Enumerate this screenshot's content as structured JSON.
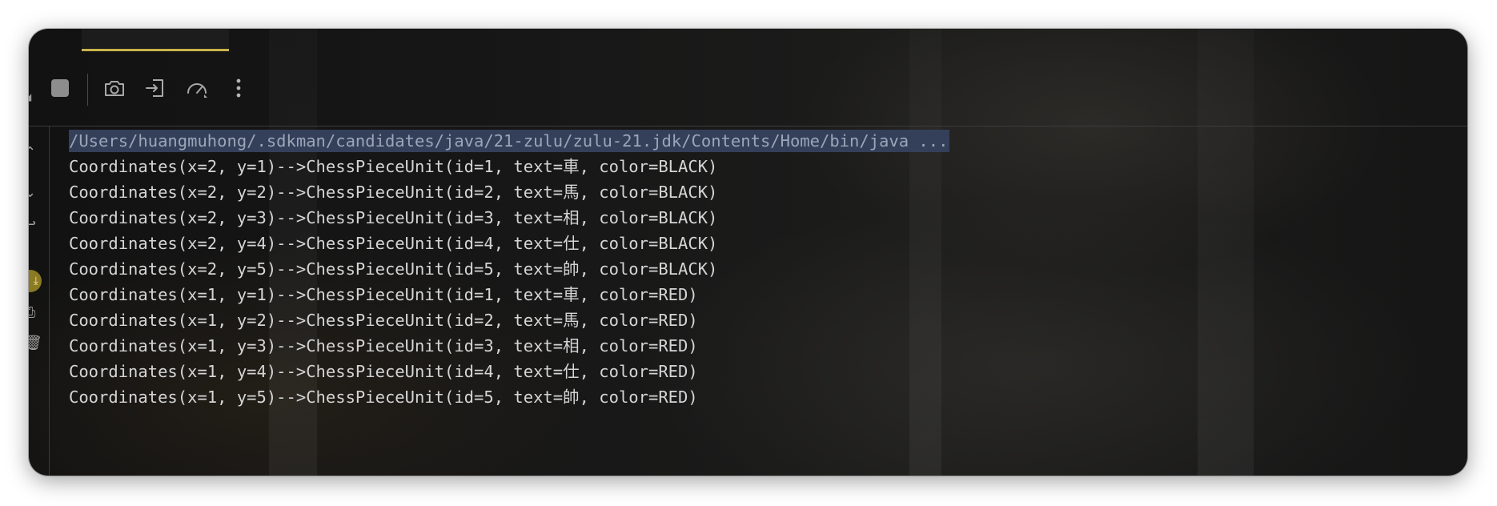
{
  "toolbar": {
    "icons": [
      "stop-icon",
      "camera-icon",
      "login-icon",
      "speedometer-icon",
      "more-vertical-icon"
    ]
  },
  "console": {
    "command": "/Users/huangmuhong/.sdkman/candidates/java/21-zulu/zulu-21.jdk/Contents/Home/bin/java ...",
    "lines": [
      "Coordinates(x=2, y=1)-->ChessPieceUnit(id=1, text=車, color=BLACK)",
      "Coordinates(x=2, y=2)-->ChessPieceUnit(id=2, text=馬, color=BLACK)",
      "Coordinates(x=2, y=3)-->ChessPieceUnit(id=3, text=相, color=BLACK)",
      "Coordinates(x=2, y=4)-->ChessPieceUnit(id=4, text=仕, color=BLACK)",
      "Coordinates(x=2, y=5)-->ChessPieceUnit(id=5, text=帥, color=BLACK)",
      "Coordinates(x=1, y=1)-->ChessPieceUnit(id=1, text=車, color=RED)",
      "Coordinates(x=1, y=2)-->ChessPieceUnit(id=2, text=馬, color=RED)",
      "Coordinates(x=1, y=3)-->ChessPieceUnit(id=3, text=相, color=RED)",
      "Coordinates(x=1, y=4)-->ChessPieceUnit(id=4, text=仕, color=RED)",
      "Coordinates(x=1, y=5)-->ChessPieceUnit(id=5, text=帥, color=RED)"
    ]
  },
  "colors": {
    "active_tab_underline": "#c9b44a",
    "selection": "#34405a",
    "text": "#d5d5d5"
  }
}
